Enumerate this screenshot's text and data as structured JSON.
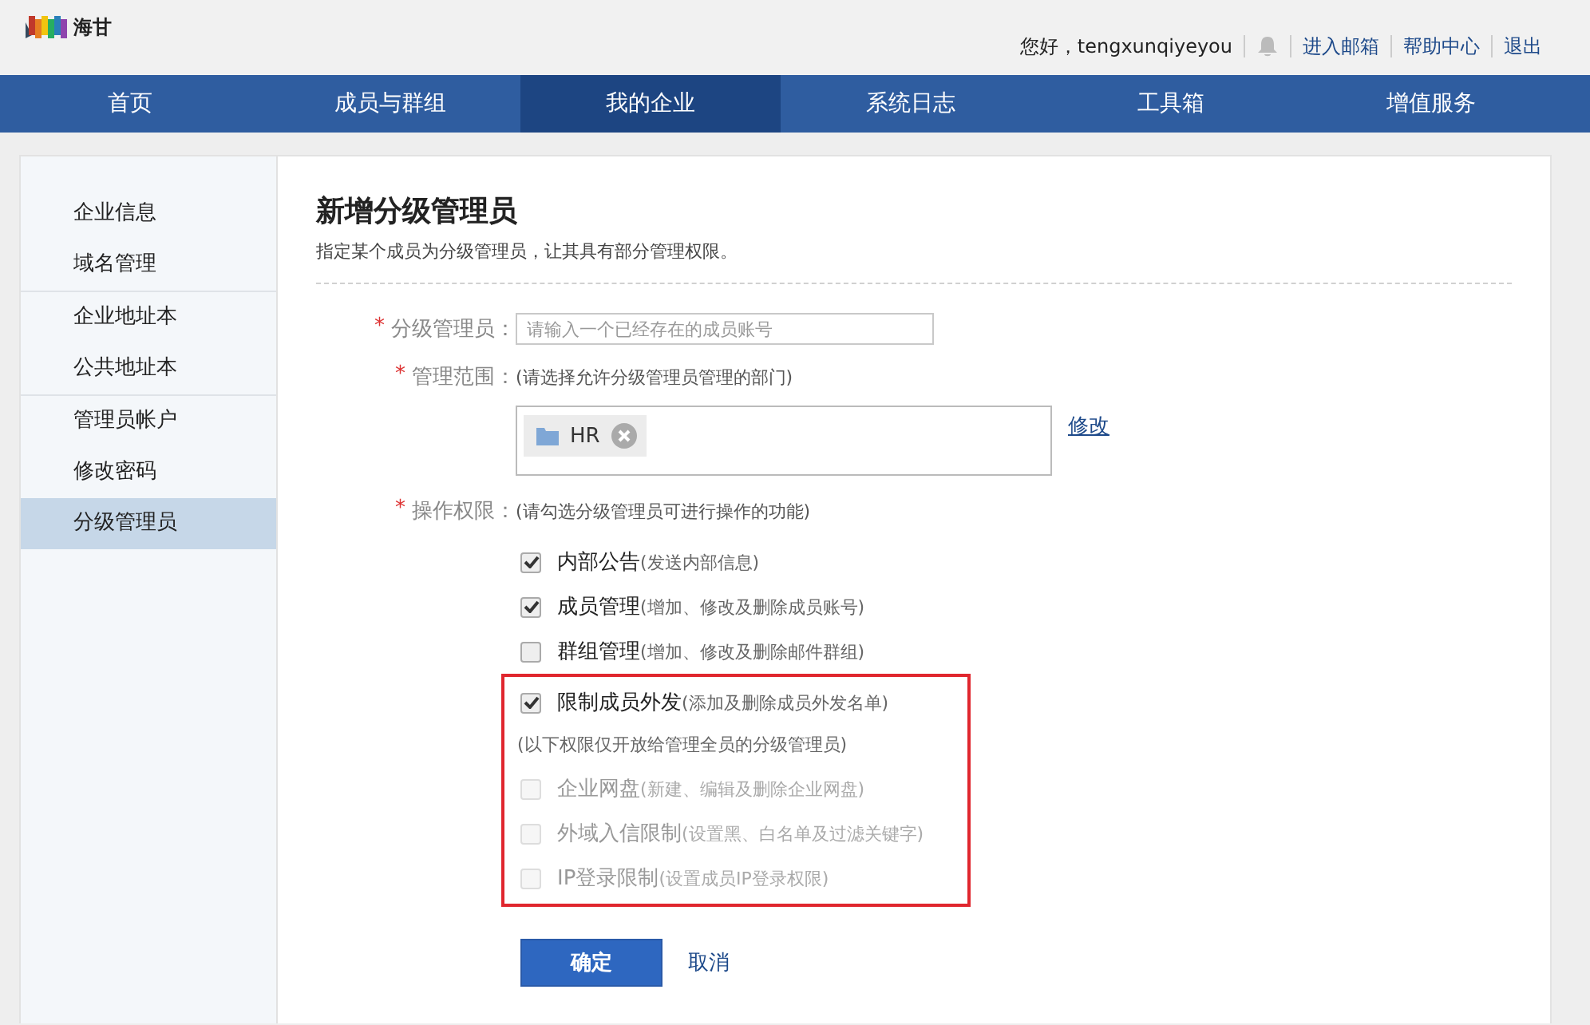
{
  "header": {
    "logo_text": "海甘",
    "greeting": "您好，tengxunqiyeyou",
    "links": [
      "进入邮箱",
      "帮助中心",
      "退出"
    ]
  },
  "nav": [
    {
      "label": "首页",
      "selected": false
    },
    {
      "label": "成员与群组",
      "selected": false
    },
    {
      "label": "我的企业",
      "selected": true
    },
    {
      "label": "系统日志",
      "selected": false
    },
    {
      "label": "工具箱",
      "selected": false
    },
    {
      "label": "增值服务",
      "selected": false
    }
  ],
  "sidebar": {
    "groups": [
      [
        {
          "label": "企业信息",
          "selected": false
        },
        {
          "label": "域名管理",
          "selected": false
        }
      ],
      [
        {
          "label": "企业地址本",
          "selected": false
        },
        {
          "label": "公共地址本",
          "selected": false
        }
      ],
      [
        {
          "label": "管理员帐户",
          "selected": false
        },
        {
          "label": "修改密码",
          "selected": false
        },
        {
          "label": "分级管理员",
          "selected": true
        }
      ]
    ]
  },
  "page": {
    "title": "新增分级管理员",
    "subtitle": "指定某个成员为分级管理员，让其具有部分管理权限。"
  },
  "form": {
    "admin": {
      "required_mark": "*",
      "label": "分级管理员：",
      "placeholder": "请输入一个已经存在的成员账号"
    },
    "scope": {
      "required_mark": "*",
      "label": "管理范围：",
      "hint": "(请选择允许分级管理员管理的部门)",
      "tags": [
        {
          "label": "HR"
        }
      ],
      "edit_link": "修改"
    },
    "permissions": {
      "required_mark": "*",
      "label": "操作权限：",
      "hint": "(请勾选分级管理员可进行操作的功能)",
      "options": [
        {
          "kind": "checkbox",
          "label": "内部公告",
          "note": "(发送内部信息)",
          "checked": true,
          "disabled": false
        },
        {
          "kind": "checkbox",
          "label": "成员管理",
          "note": "(增加、修改及删除成员账号)",
          "checked": true,
          "disabled": false
        },
        {
          "kind": "checkbox",
          "label": "群组管理",
          "note": "(增加、修改及删除邮件群组)",
          "checked": false,
          "disabled": false
        }
      ],
      "highlighted_options": [
        {
          "kind": "checkbox",
          "label": "限制成员外发",
          "note": "(添加及删除成员外发名单)",
          "checked": true,
          "disabled": false
        },
        {
          "kind": "note",
          "text": "(以下权限仅开放给管理全员的分级管理员)"
        },
        {
          "kind": "checkbox",
          "label": "企业网盘",
          "note": "(新建、编辑及删除企业网盘)",
          "checked": false,
          "disabled": true
        },
        {
          "kind": "checkbox",
          "label": "外域入信限制",
          "note": "(设置黑、白名单及过滤关键字)",
          "checked": false,
          "disabled": true
        },
        {
          "kind": "checkbox",
          "label": "IP登录限制",
          "note": "(设置成员IP登录权限)",
          "checked": false,
          "disabled": true
        }
      ]
    }
  },
  "buttons": {
    "confirm": "确定",
    "cancel": "取消"
  }
}
